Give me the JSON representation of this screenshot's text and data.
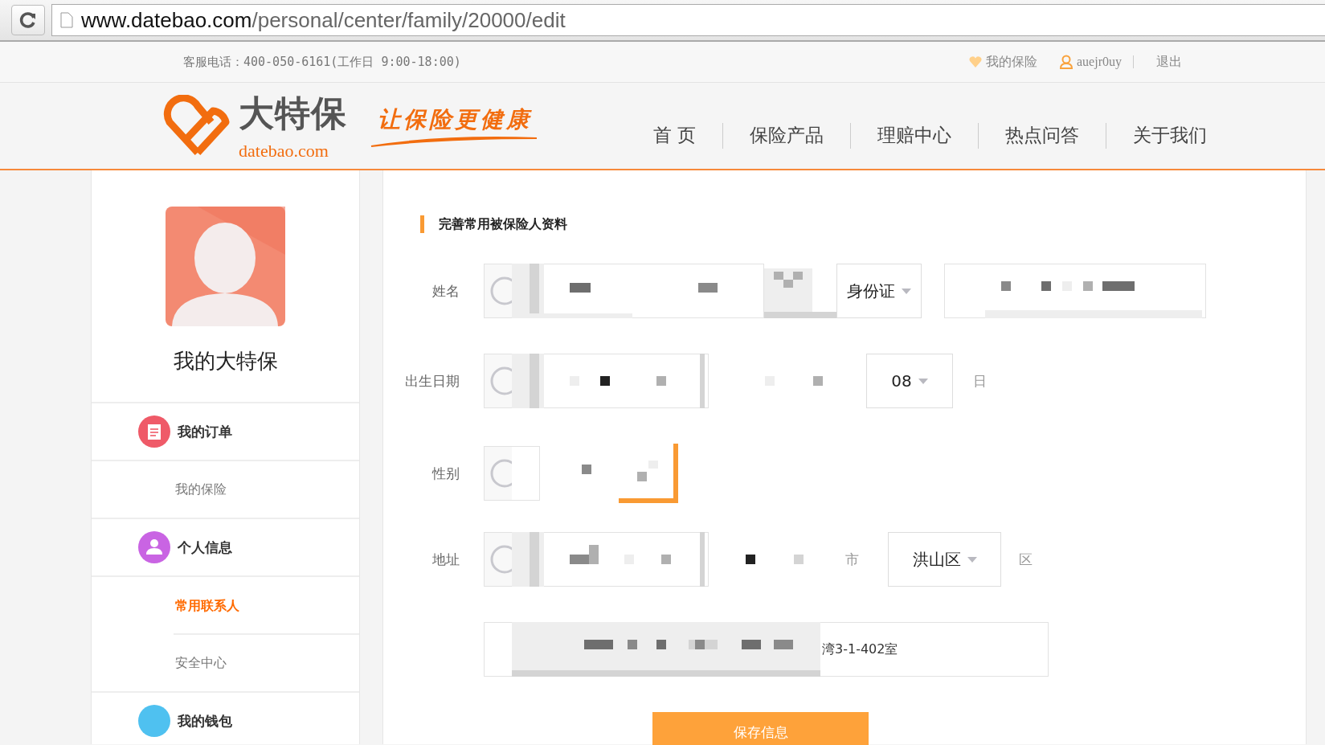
{
  "browser": {
    "url_host": "www.datebao.com",
    "url_path": "/personal/center/family/20000/edit"
  },
  "topbar": {
    "hotline": "客服电话：400-050-6161(工作日 9:00-18:00)",
    "links": [
      {
        "kind": "insurance",
        "label": "我的保险"
      },
      {
        "kind": "user",
        "label": "auejr0uy"
      },
      {
        "kind": "plain",
        "label": "退出"
      }
    ]
  },
  "header": {
    "logo_name": "大特保",
    "logo_domain": "datebao.com",
    "slogan": "让保险更健康",
    "nav": [
      {
        "label": "首 页"
      },
      {
        "label": "保险产品"
      },
      {
        "label": "理赔中心"
      },
      {
        "label": "热点问答"
      },
      {
        "label": "关于我们"
      }
    ]
  },
  "sidebar": {
    "title": "我的大特保",
    "items": [
      {
        "kind": "group",
        "label": "我的订单",
        "color": "#ef5a68"
      },
      {
        "kind": "sub",
        "label": "我的保险",
        "selected": false
      },
      {
        "kind": "group",
        "label": "个人信息",
        "color": "#c964e3"
      },
      {
        "kind": "sub",
        "label": "常用联系人",
        "selected": true
      },
      {
        "kind": "sub",
        "label": "安全中心",
        "selected": false
      },
      {
        "kind": "group",
        "label": "我的钱包",
        "color": "#4fc1f0"
      }
    ]
  },
  "form": {
    "title": "完善常用被保险人资料",
    "name_label": "姓名",
    "id_type": "身份证",
    "birth_label": "出生日期",
    "birth_day": "08",
    "day_unit": "日",
    "gender_label": "性别",
    "gender_options": [
      {
        "selected": false
      },
      {
        "selected": true
      }
    ],
    "address_label": "地址",
    "city_unit": "市",
    "district": "洪山区",
    "district_unit": "区",
    "address_detail": "湾3-1-402室",
    "save_button": "保存信息"
  }
}
